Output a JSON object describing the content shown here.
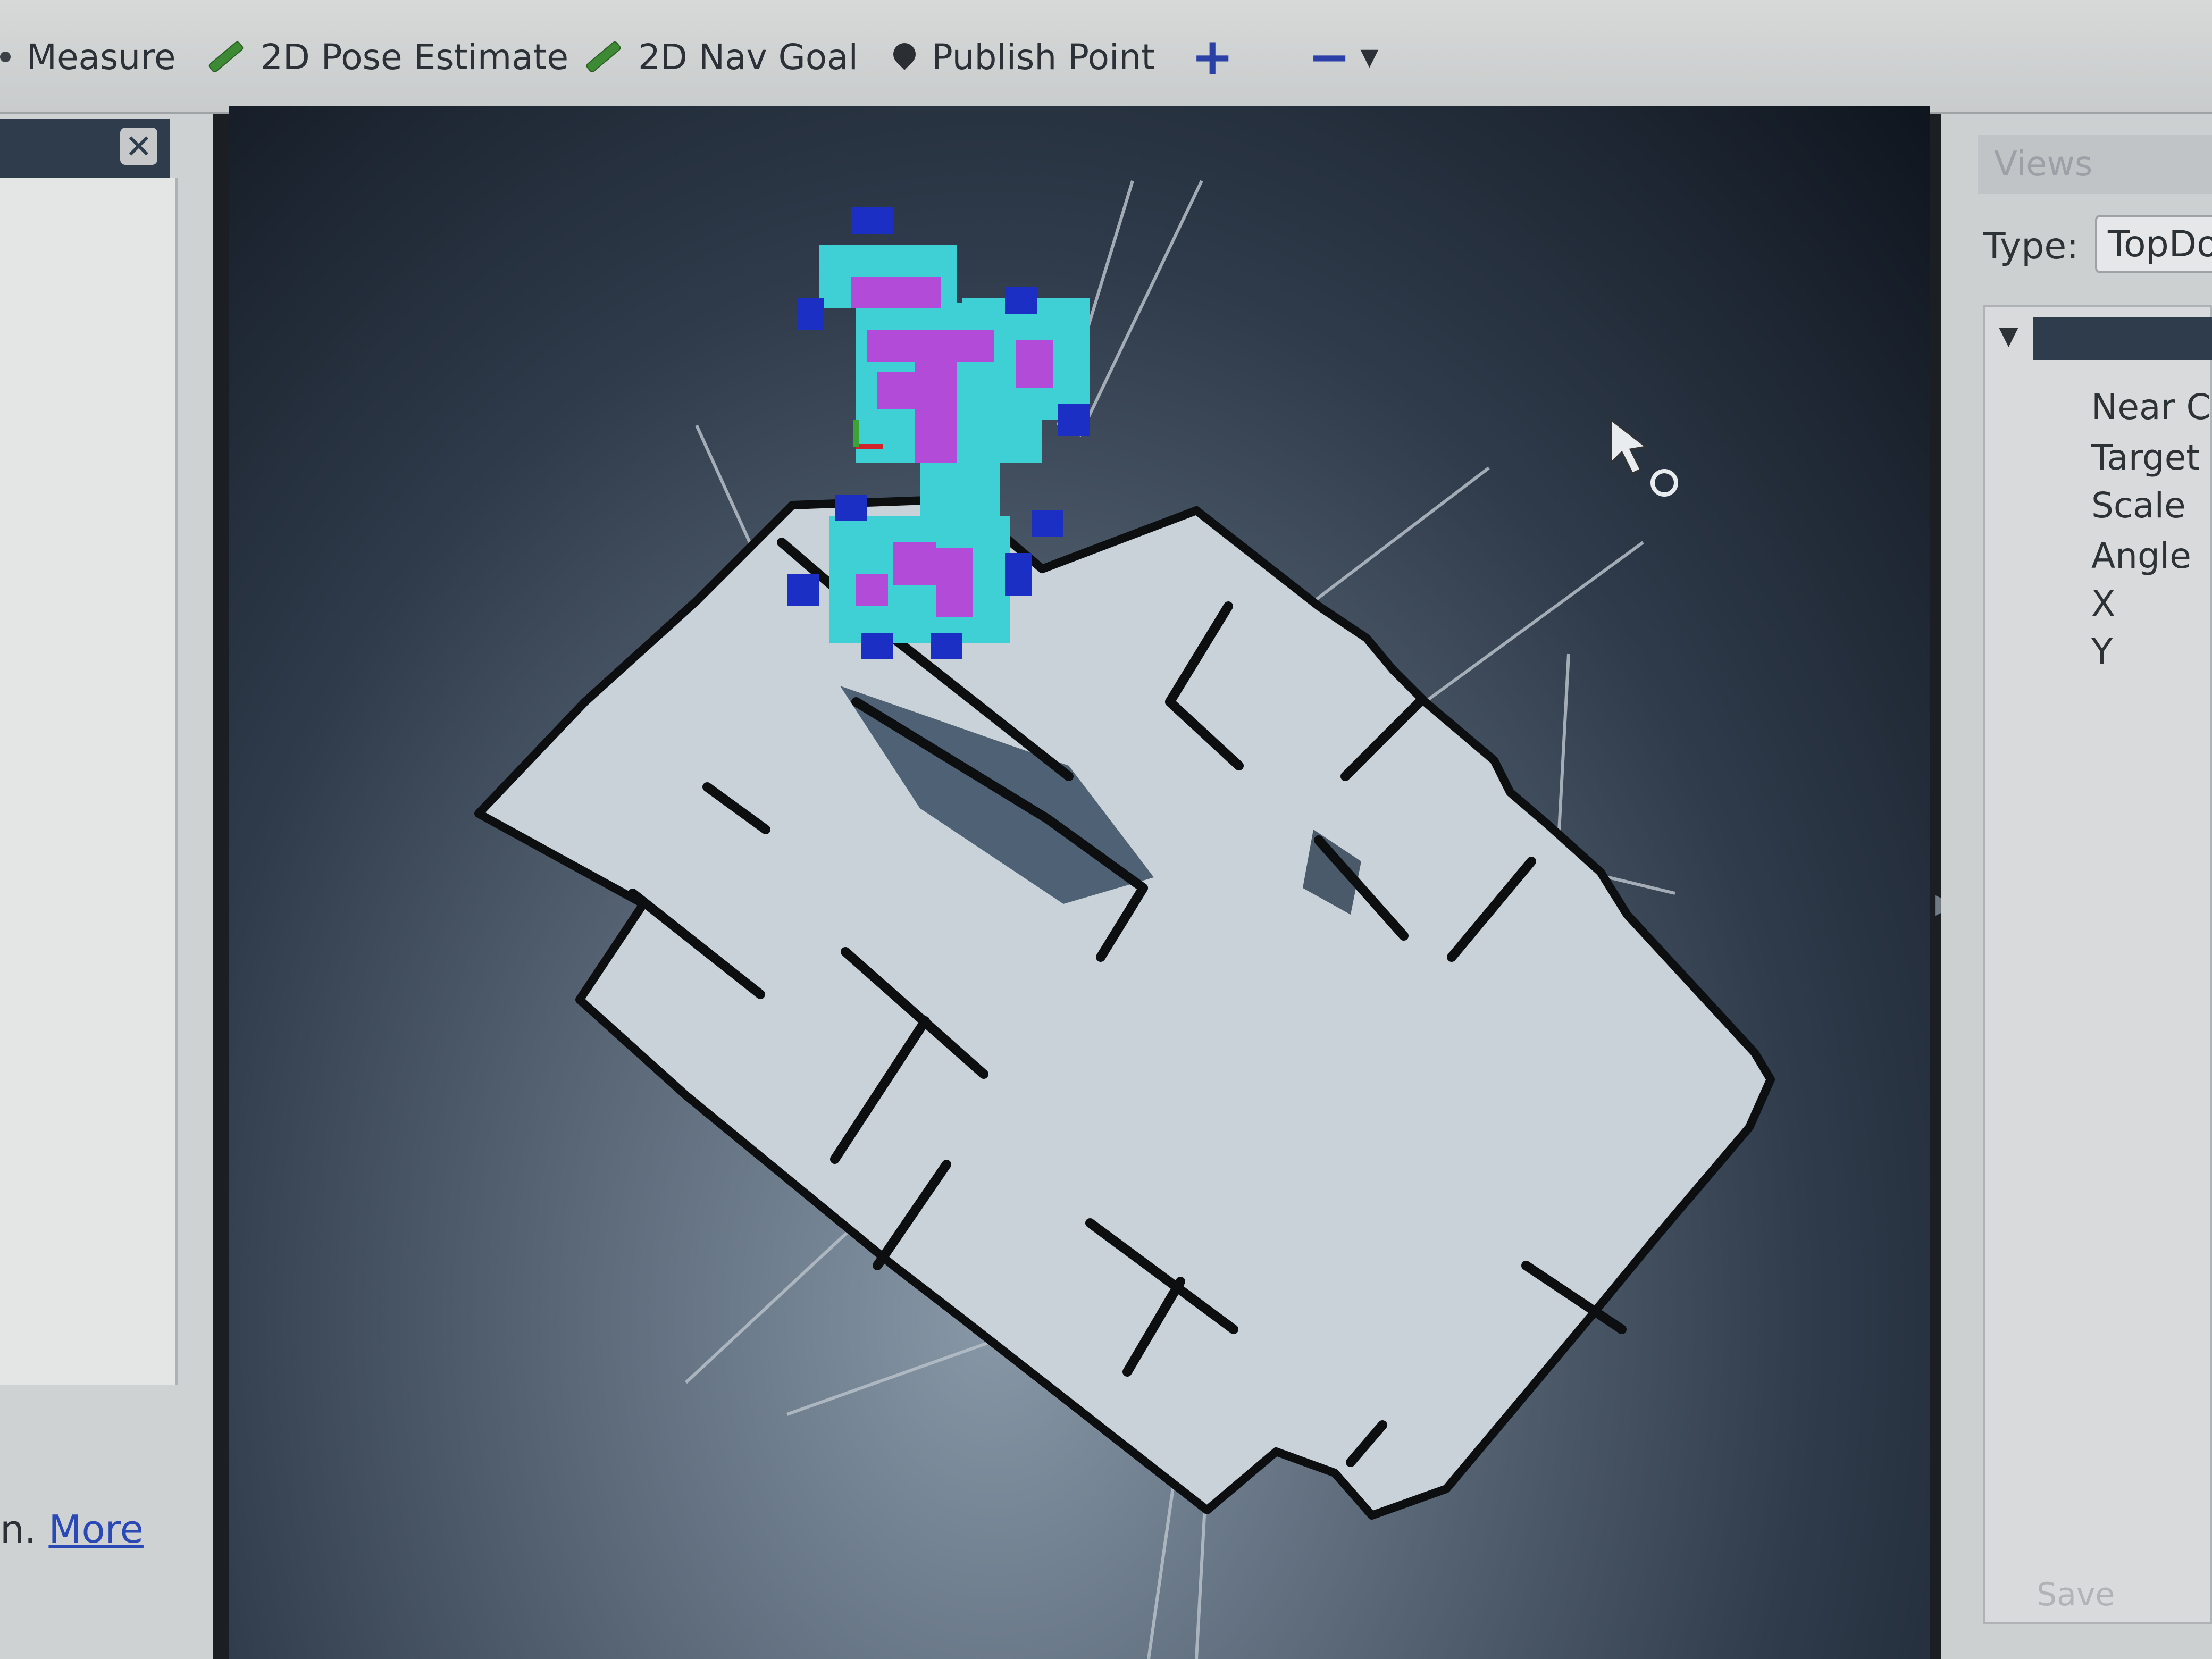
{
  "toolbar": {
    "measure_label": "Measure",
    "pose_label": "2D Pose Estimate",
    "nav_label": "2D Nav Goal",
    "publish_label": "Publish Point"
  },
  "left_panel": {
    "help_prefix": "n.",
    "more_link": "More"
  },
  "views_panel": {
    "title": "Views",
    "type_label": "Type:",
    "type_value": "TopDo",
    "properties": [
      "Near Cl",
      "Target I",
      "Scale",
      "Angle",
      "X",
      "Y"
    ],
    "save_label": "Save"
  },
  "colors": {
    "map_free": "#c9d1d9",
    "map_wall": "#0c0e10",
    "costmap_cyan": "#3fd0d6",
    "costmap_magenta": "#b24bd8",
    "costmap_blue": "#1c2fc4"
  }
}
